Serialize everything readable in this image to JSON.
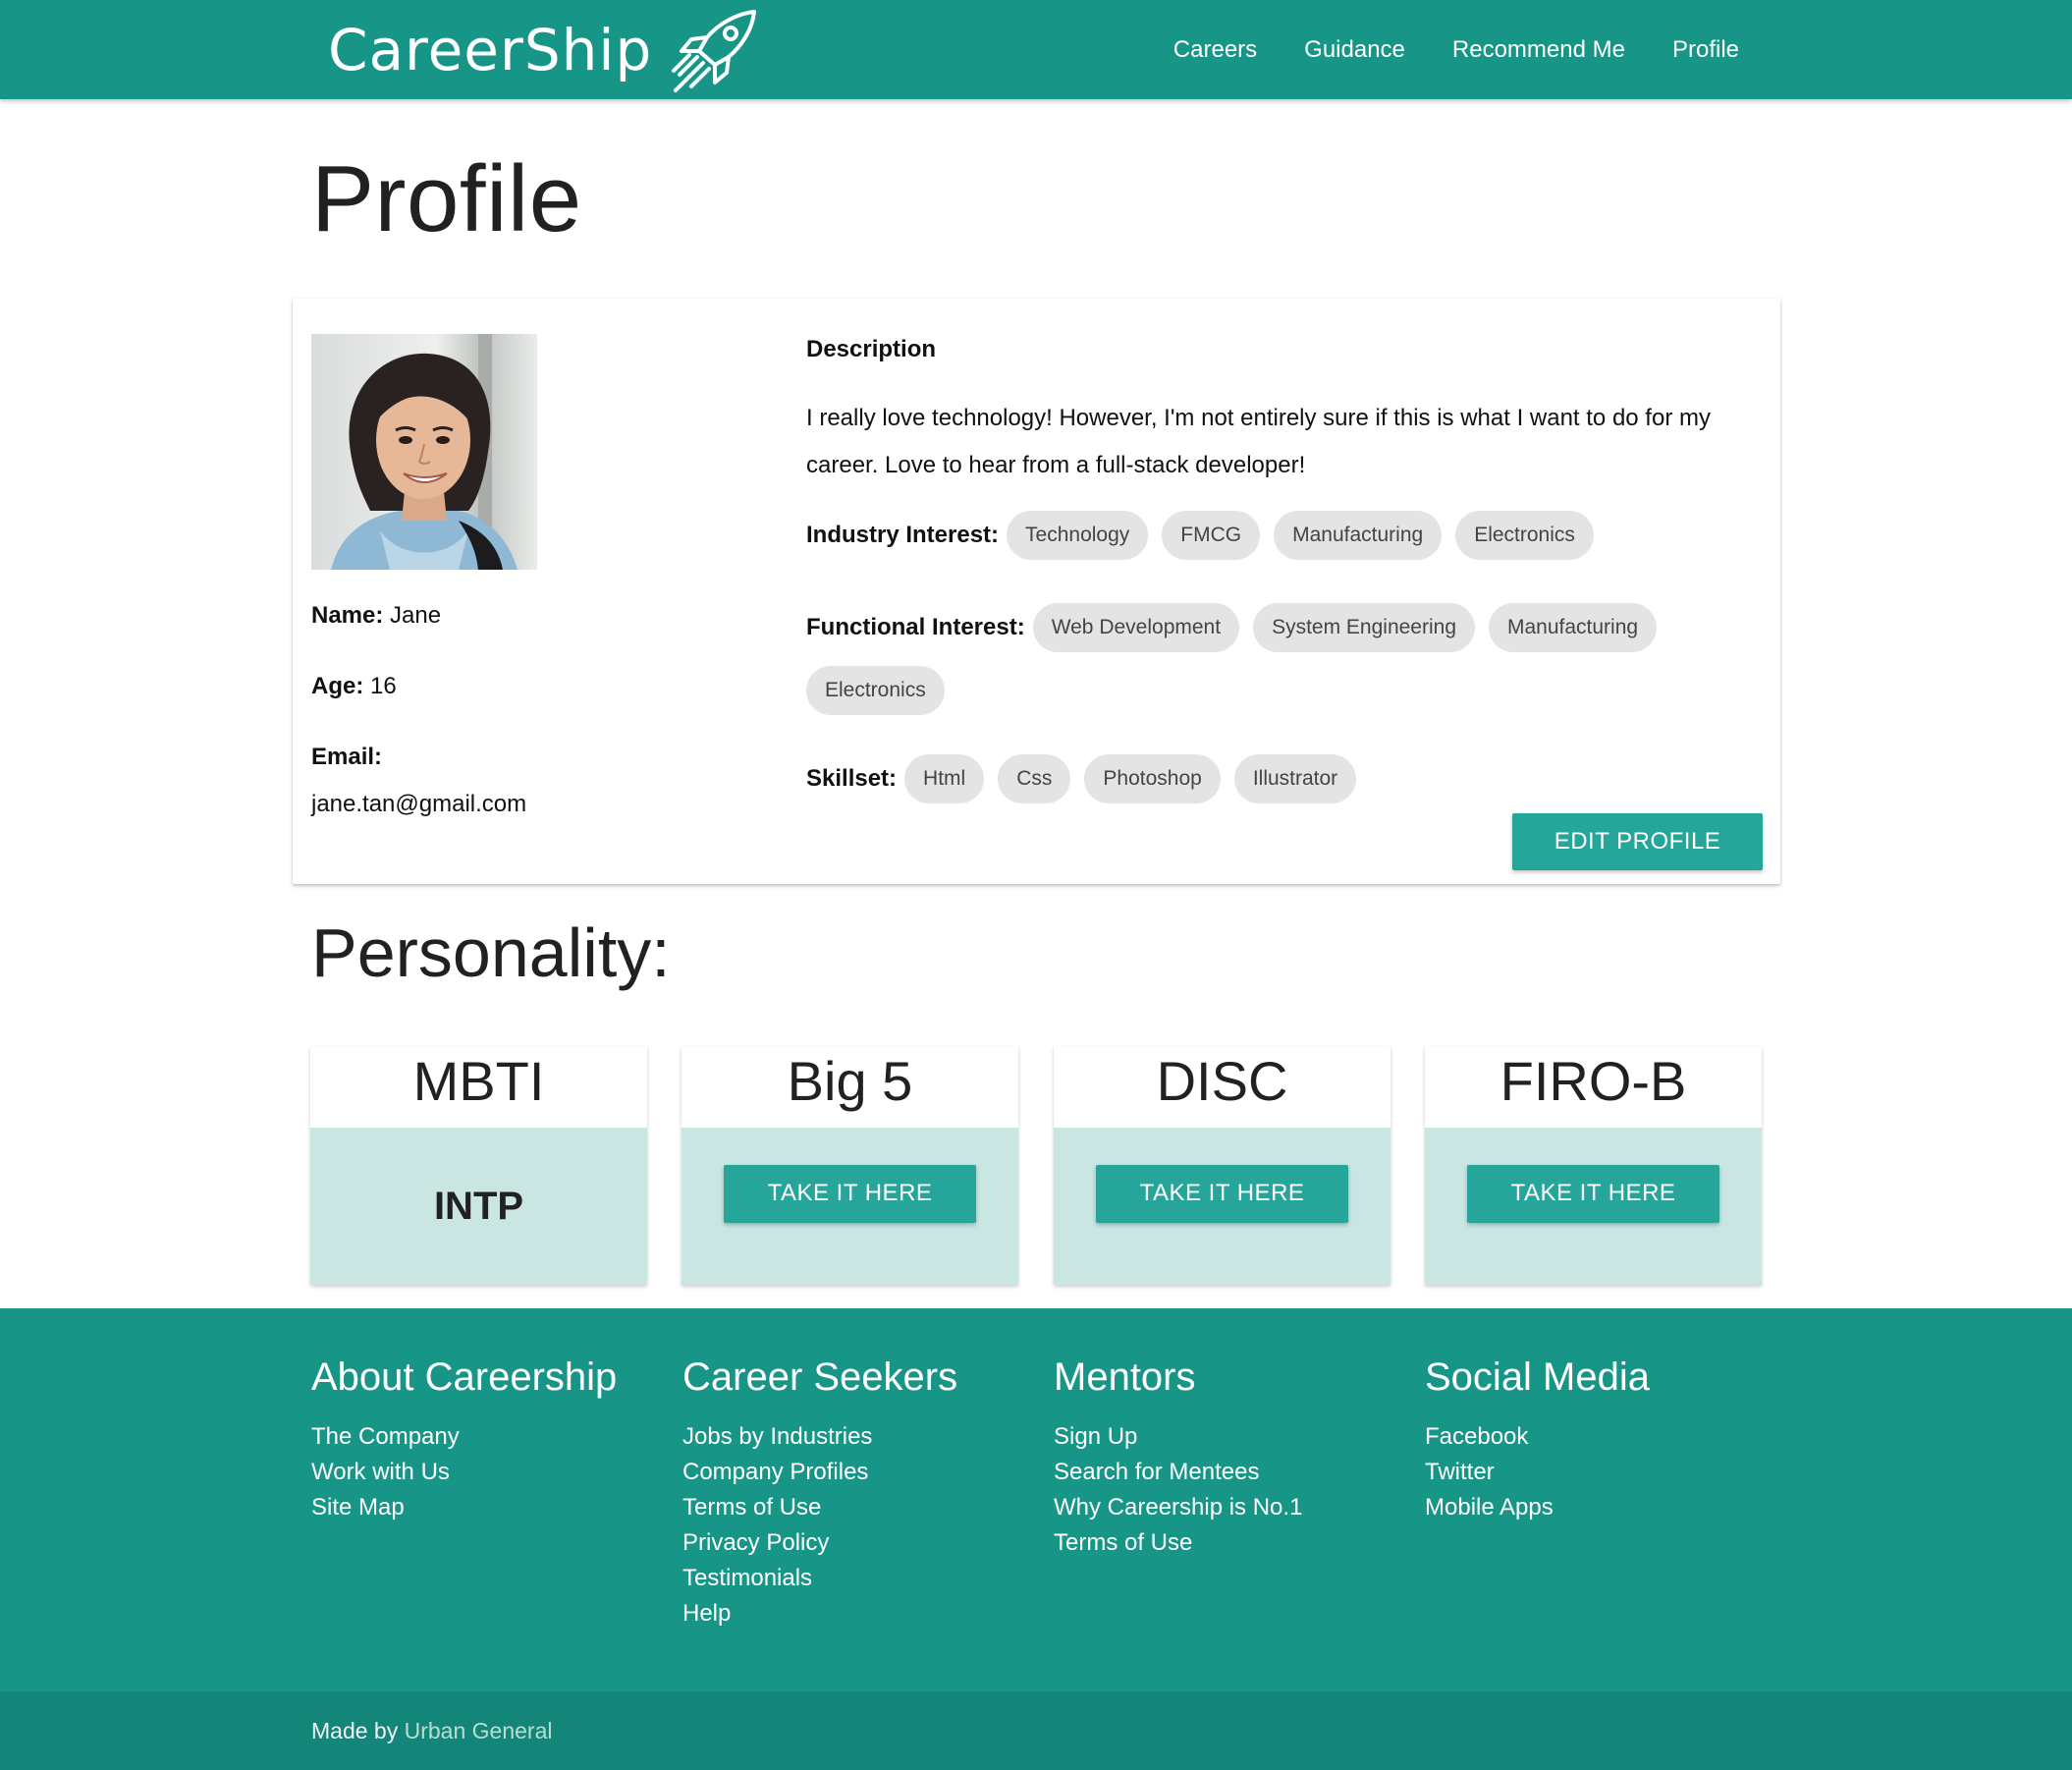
{
  "nav": {
    "brand": "CareerShip",
    "links": [
      "Careers",
      "Guidance",
      "Recommend Me",
      "Profile"
    ]
  },
  "page": {
    "title": "Profile"
  },
  "profile": {
    "name_label": "Name:",
    "name": "Jane",
    "age_label": "Age:",
    "age": "16",
    "email_label": "Email:",
    "email": "jane.tan@gmail.com",
    "description_heading": "Description",
    "description": "I really love technology! However, I'm not entirely sure if this is what I want to do for my career. Love to hear from a full-stack developer!",
    "industry_label": "Industry Interest:",
    "industry": [
      "Technology",
      "FMCG",
      "Manufacturing",
      "Electronics"
    ],
    "functional_label": "Functional Interest:",
    "functional": [
      "Web Development",
      "System Engineering",
      "Manufacturing",
      "Electronics"
    ],
    "skillset_label": "Skillset:",
    "skillset": [
      "Html",
      "Css",
      "Photoshop",
      "Illustrator"
    ],
    "edit_button": "EDIT PROFILE"
  },
  "personality": {
    "title": "Personality:",
    "cards": [
      {
        "name": "MBTI",
        "result": "INTP"
      },
      {
        "name": "Big 5",
        "button": "TAKE IT HERE"
      },
      {
        "name": "DISC",
        "button": "TAKE IT HERE"
      },
      {
        "name": "FIRO-B",
        "button": "TAKE IT HERE"
      }
    ]
  },
  "footer": {
    "columns": [
      {
        "heading": "About Careership",
        "links": [
          "The Company",
          "Work with Us",
          "Site Map"
        ]
      },
      {
        "heading": "Career Seekers",
        "links": [
          "Jobs by Industries",
          "Company Profiles",
          "Terms of Use",
          "Privacy Policy",
          "Testimonials",
          "Help"
        ]
      },
      {
        "heading": "Mentors",
        "links": [
          "Sign Up",
          "Search for Mentees",
          "Why Careership is No.1",
          "Terms of Use"
        ]
      },
      {
        "heading": "Social Media",
        "links": [
          "Facebook",
          "Twitter",
          "Mobile Apps"
        ]
      }
    ],
    "made_by": "Made by",
    "credit": "Urban General"
  },
  "colors": {
    "primary": "#179688",
    "button": "#26a69a",
    "card_tint": "#c9e6e2",
    "chip": "#e4e4e4"
  }
}
